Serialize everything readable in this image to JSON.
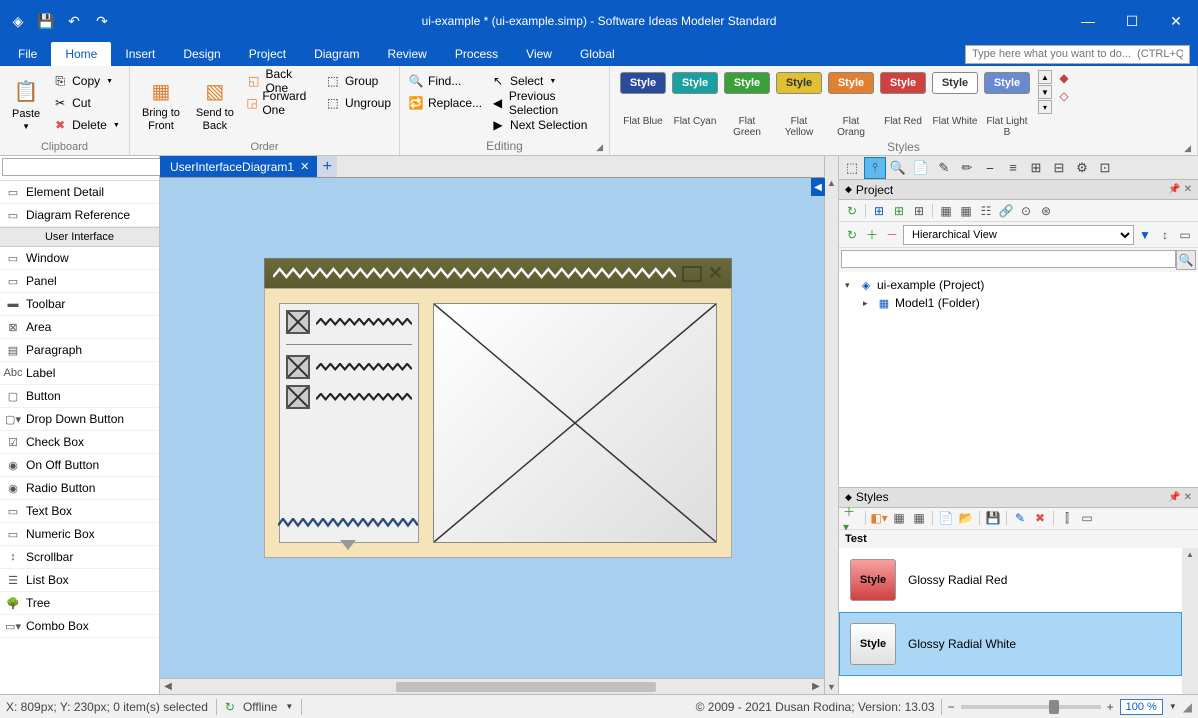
{
  "title": "ui-example * (ui-example.simp) - Software Ideas Modeler Standard",
  "menu": [
    "File",
    "Home",
    "Insert",
    "Design",
    "Project",
    "Diagram",
    "Review",
    "Process",
    "View",
    "Global"
  ],
  "search_placeholder": "Type here what you want to do...  (CTRL+Q)",
  "ribbon": {
    "clipboard": {
      "label": "Clipboard",
      "paste": "Paste",
      "copy": "Copy",
      "cut": "Cut",
      "delete": "Delete"
    },
    "order": {
      "label": "Order",
      "bring_front": "Bring to\nFront",
      "send_back": "Send to\nBack",
      "back_one": "Back One",
      "forward_one": "Forward One",
      "group": "Group",
      "ungroup": "Ungroup"
    },
    "editing": {
      "label": "Editing",
      "find": "Find...",
      "replace": "Replace...",
      "select": "Select",
      "prev_sel": "Previous Selection",
      "next_sel": "Next Selection"
    },
    "styles": {
      "label": "Styles",
      "btn": "Style",
      "names": [
        "Flat Blue",
        "Flat Cyan",
        "Flat Green",
        "Flat Yellow",
        "Flat Orang",
        "Flat Red",
        "Flat White",
        "Flat Light B"
      ],
      "colors": [
        "#2a4a9a",
        "#1aa0a0",
        "#3aa03a",
        "#e0c030",
        "#e08030",
        "#d04040",
        "#ffffff",
        "#6a8ad0"
      ]
    }
  },
  "toolbox": {
    "element_detail": "Element Detail",
    "diagram_ref": "Diagram Reference",
    "category": "User Interface",
    "items": [
      "Window",
      "Panel",
      "Toolbar",
      "Area",
      "Paragraph",
      "Label",
      "Button",
      "Drop Down Button",
      "Check Box",
      "On Off Button",
      "Radio Button",
      "Text Box",
      "Numeric Box",
      "Scrollbar",
      "List Box",
      "Tree",
      "Combo Box"
    ]
  },
  "tab": "UserInterfaceDiagram1",
  "project_panel": {
    "title": "Project",
    "view_mode": "Hierarchical View",
    "root": "ui-example (Project)",
    "child": "Model1 (Folder)"
  },
  "styles_panel": {
    "title": "Styles",
    "category": "Test",
    "items": [
      {
        "name": "Glossy Radial Red",
        "bg": "linear-gradient(#f8a0a0, #d04040)"
      },
      {
        "name": "Glossy Radial White",
        "bg": "linear-gradient(#ffffff, #e0e0e0)"
      }
    ]
  },
  "statusbar": {
    "coords": "X: 809px; Y: 230px; 0 item(s) selected",
    "offline": "Offline",
    "copyright": "© 2009 - 2021 Dusan Rodina; Version: 13.03",
    "zoom": "100 %"
  }
}
